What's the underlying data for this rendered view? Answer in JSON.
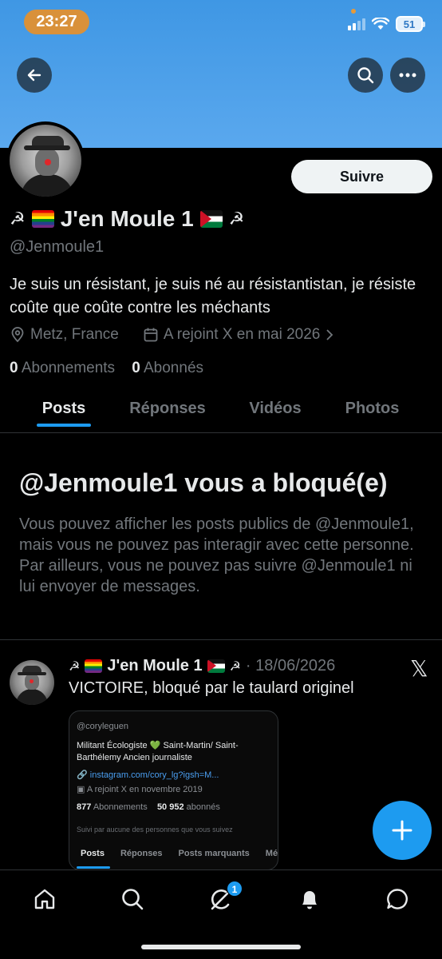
{
  "status_bar": {
    "time": "23:27",
    "battery": "51"
  },
  "profile": {
    "display_name": "J'en Moule 1",
    "prefix_symbols": "☭",
    "suffix_symbols": "☭",
    "handle": "@Jenmoule1",
    "bio": "Je suis un résistant, je suis né au résistantistan, je résiste coûte que coûte contre les méchants",
    "location": "Metz, France",
    "joined": "A rejoint X en mai 2026",
    "following_count": "0",
    "following_label": "Abonnements",
    "followers_count": "0",
    "followers_label": "Abonnés",
    "follow_label": "Suivre"
  },
  "tabs": [
    {
      "label": "Posts",
      "active": true
    },
    {
      "label": "Réponses",
      "active": false
    },
    {
      "label": "Vidéos",
      "active": false
    },
    {
      "label": "Photos",
      "active": false
    }
  ],
  "blocked": {
    "title": "@Jenmoule1 vous a bloqué(e)",
    "text": "Vous pouvez afficher les posts publics de @Jenmoule1, mais vous ne pouvez pas interagir avec cette personne. Par ailleurs, vous ne pouvez pas suivre @Jenmoule1 ni lui envoyer de messages."
  },
  "post": {
    "author": "J'en Moule 1",
    "symbols": "☭",
    "date": "· 18/06/2026",
    "text": "VICTOIRE, bloqué par le taulard originel",
    "embed": {
      "handle": "@coryleguen",
      "bio": "Militant Écologiste 💚 Saint-Martin/ Saint-Barthélemy Ancien journaliste",
      "link": "instagram.com/cory_lg?igsh=M...",
      "joined": "A rejoint X en novembre 2019",
      "following_count": "877",
      "following_label": "Abonnements",
      "followers_count": "50 952",
      "followers_label": "abonnés",
      "note": "Suivi par aucune des personnes que vous suivez",
      "tabs": [
        "Posts",
        "Réponses",
        "Posts marquants",
        "Mé"
      ]
    }
  },
  "bottom_nav": {
    "items": [
      "home-icon",
      "search-icon",
      "grok-icon",
      "notifications-icon",
      "messages-icon"
    ],
    "grok_badge": "1"
  },
  "colors": {
    "accent": "#1d9bf0",
    "banner": "#4a9fe9",
    "muted": "#71767b",
    "time_pill": "#d9913a"
  }
}
